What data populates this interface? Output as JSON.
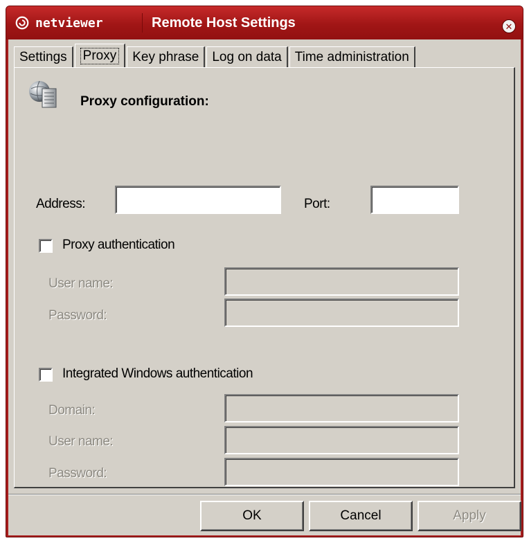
{
  "window": {
    "brand": "netviewer",
    "title": "Remote Host Settings",
    "close_icon": "close-icon",
    "accent_color": "#a61d1d"
  },
  "tabs": [
    {
      "label": "Settings",
      "active": false
    },
    {
      "label": "Proxy",
      "active": true
    },
    {
      "label": "Key phrase",
      "active": false
    },
    {
      "label": "Log on data",
      "active": false
    },
    {
      "label": "Time administration",
      "active": false
    }
  ],
  "proxy": {
    "section_icon": "server-globe-icon",
    "section_title": "Proxy configuration:",
    "address_label": "Address:",
    "address_value": "",
    "port_label": "Port:",
    "port_value": "",
    "proxy_auth": {
      "label": "Proxy authentication",
      "checked": false,
      "username_label": "User name:",
      "username_value": "",
      "password_label": "Password:",
      "password_value": ""
    },
    "windows_auth": {
      "label": "Integrated Windows authentication",
      "checked": false,
      "domain_label": "Domain:",
      "domain_value": "",
      "username_label": "User name:",
      "username_value": "",
      "password_label": "Password:",
      "password_value": ""
    }
  },
  "buttons": {
    "ok": "OK",
    "cancel": "Cancel",
    "apply": "Apply"
  }
}
